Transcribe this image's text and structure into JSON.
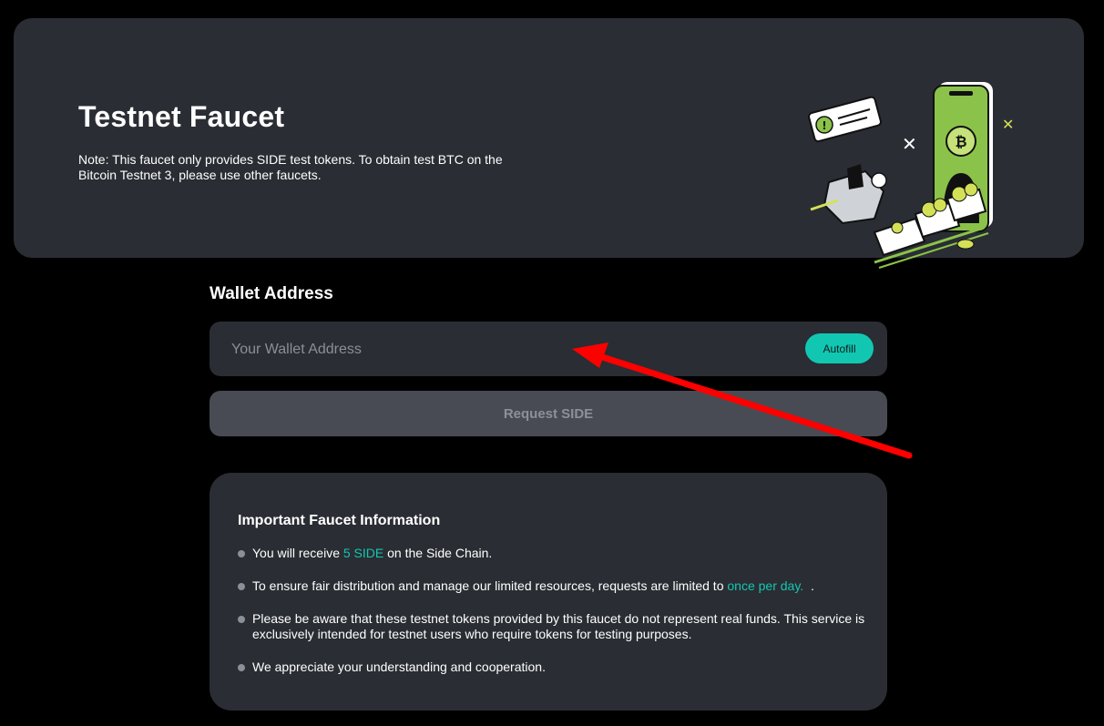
{
  "hero": {
    "title": "Testnet Faucet",
    "note": "Note: This faucet only provides SIDE test tokens. To obtain test BTC on the Bitcoin Testnet 3, please use other faucets."
  },
  "wallet": {
    "label": "Wallet Address",
    "placeholder": "Your Wallet Address",
    "value": "",
    "autofill_label": "Autofill"
  },
  "request_button_label": "Request SIDE",
  "info": {
    "title": "Important Faucet Information",
    "items": [
      {
        "before": "You will receive ",
        "highlight": "5 SIDE",
        "after": " on the Side Chain."
      },
      {
        "before": "To ensure fair distribution and manage our limited resources, requests are limited to ",
        "highlight": "once per day.",
        "after": "  ."
      },
      {
        "before": "Please be aware that these testnet tokens provided by this faucet do not represent real funds. This service is exclusively intended for testnet users who require tokens for testing purposes.",
        "highlight": "",
        "after": ""
      },
      {
        "before": "We appreciate your understanding and cooperation.",
        "highlight": "",
        "after": ""
      }
    ]
  },
  "colors": {
    "background": "#000000",
    "card": "#2a2d33",
    "accent": "#12c7b2",
    "button_disabled": "#484b53",
    "annotation_arrow": "#ff0000",
    "illustration_green": "#8bc34a",
    "illustration_yellow": "#d4e157"
  },
  "illustration_icons": [
    "phone-bitcoin-icon",
    "alert-bubble-icon",
    "mine-cart-icon",
    "robot-miner-icon",
    "coin-icon"
  ]
}
